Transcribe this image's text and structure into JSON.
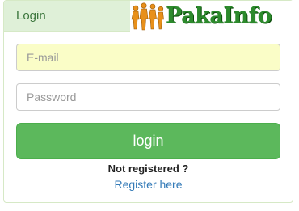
{
  "panel": {
    "title": "Login"
  },
  "logo": {
    "text": "PakaInfo",
    "icon": "people-group-icon",
    "colors": {
      "text": "#2c8a2c",
      "figures": "#e8901a"
    }
  },
  "form": {
    "email_placeholder": "E-mail",
    "email_value": "",
    "password_placeholder": "Password",
    "password_value": "",
    "login_label": "login"
  },
  "footer": {
    "not_registered": "Not registered ?",
    "register_link": "Register here"
  },
  "colors": {
    "heading_bg": "#dff0d8",
    "button": "#5cb85c",
    "link": "#337ab7",
    "email_bg": "#fafdc7"
  }
}
